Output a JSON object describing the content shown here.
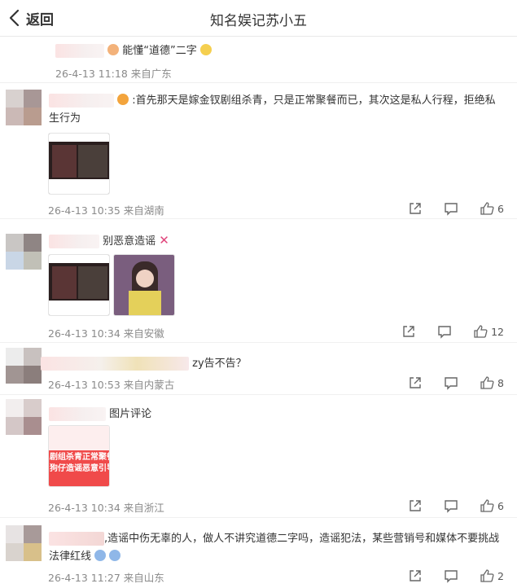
{
  "header": {
    "back_label": "返回",
    "title": "知名娱记苏小五"
  },
  "comments": [
    {
      "text": "能懂“道德”二字",
      "meta": "26-4-13 11:18 来自广东"
    },
    {
      "text": ":首先那天是嫁金钗剧组杀青，只是正常聚餐而已，其次这是私人行程，拒绝私生行为",
      "meta": "26-4-13 10:35 来自湖南",
      "likes": "6"
    },
    {
      "text": "别恶意造谣",
      "meta": "26-4-13 10:34 来自安徽",
      "likes": "12"
    },
    {
      "text": "zy告不告？",
      "meta": "26-4-13 10:53 来自内蒙古",
      "likes": "8"
    },
    {
      "text": "图片评论",
      "meta": "26-4-13 10:34 来自浙江",
      "likes": "6",
      "image_text_1": "剧组杀青正常聚餐",
      "image_text_2": "狗仔造谣恶意引导"
    },
    {
      "text": ",造谣中伤无辜的人，做人不讲究道德二字吗，造谣犯法，某些营销号和媒体不要挑战法律红线",
      "meta": "26-4-13 11:27 来自山东",
      "likes": "2"
    }
  ],
  "icons": [
    "chevron-left-icon",
    "share-icon",
    "comment-icon",
    "like-icon"
  ],
  "colors": {
    "meta": "#8a8a8a",
    "text": "#333333",
    "heart": "#e0457b"
  }
}
